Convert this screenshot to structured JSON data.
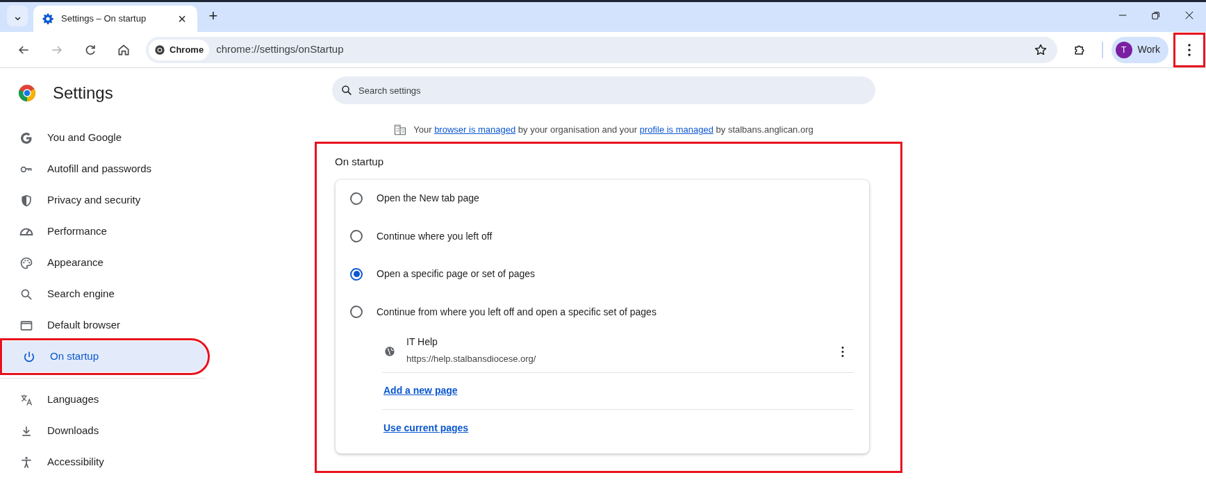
{
  "browser": {
    "tab_list_button": "⌄",
    "tabs": [
      {
        "title": "Settings – On startup",
        "selected": true,
        "close": "×"
      }
    ],
    "new_tab": "+",
    "chip": "Chrome",
    "address": "chrome://settings/onStartup",
    "profile": {
      "initial": "T",
      "name": "Work"
    },
    "menu_button": {
      "highlighted": true
    }
  },
  "header": {
    "title": "Settings"
  },
  "search": {
    "placeholder": "Search settings"
  },
  "sidebar": {
    "items": [
      {
        "kind": "google",
        "label": "You and Google",
        "selected": false,
        "highlighted": false
      },
      {
        "kind": "key",
        "label": "Autofill and passwords",
        "selected": false,
        "highlighted": false
      },
      {
        "kind": "shield",
        "label": "Privacy and security",
        "selected": false,
        "highlighted": false
      },
      {
        "kind": "gauge",
        "label": "Performance",
        "selected": false,
        "highlighted": false
      },
      {
        "kind": "palette",
        "label": "Appearance",
        "selected": false,
        "highlighted": false
      },
      {
        "kind": "search",
        "label": "Search engine",
        "selected": false,
        "highlighted": false
      },
      {
        "kind": "window",
        "label": "Default browser",
        "selected": false,
        "highlighted": false
      },
      {
        "kind": "power",
        "label": "On startup",
        "selected": true,
        "highlighted": true
      },
      {
        "kind": "divider"
      },
      {
        "kind": "translate",
        "label": "Languages",
        "selected": false,
        "highlighted": false
      },
      {
        "kind": "download",
        "label": "Downloads",
        "selected": false,
        "highlighted": false
      },
      {
        "kind": "accessibility",
        "label": "Accessibility",
        "selected": false,
        "highlighted": false
      }
    ]
  },
  "managed_notice": [
    {
      "kind": "text",
      "text": "Your "
    },
    {
      "kind": "link",
      "text": "browser is managed"
    },
    {
      "kind": "text",
      "text": " by your organisation and your "
    },
    {
      "kind": "link",
      "text": "profile is managed"
    },
    {
      "kind": "text",
      "text": " by stalbans.anglican.org"
    }
  ],
  "section": {
    "title": "On startup",
    "highlighted": true,
    "options": [
      {
        "label": "Open the New tab page",
        "selected": false
      },
      {
        "label": "Continue where you left off",
        "selected": false
      },
      {
        "label": "Open a specific page or set of pages",
        "selected": true
      },
      {
        "label": "Continue from where you left off and open a specific set of pages",
        "selected": false
      }
    ],
    "pages": [
      {
        "name": "IT Help",
        "url": "https://help.stalbansdiocese.org/"
      }
    ],
    "links": [
      "Add a new page",
      "Use current pages"
    ]
  }
}
